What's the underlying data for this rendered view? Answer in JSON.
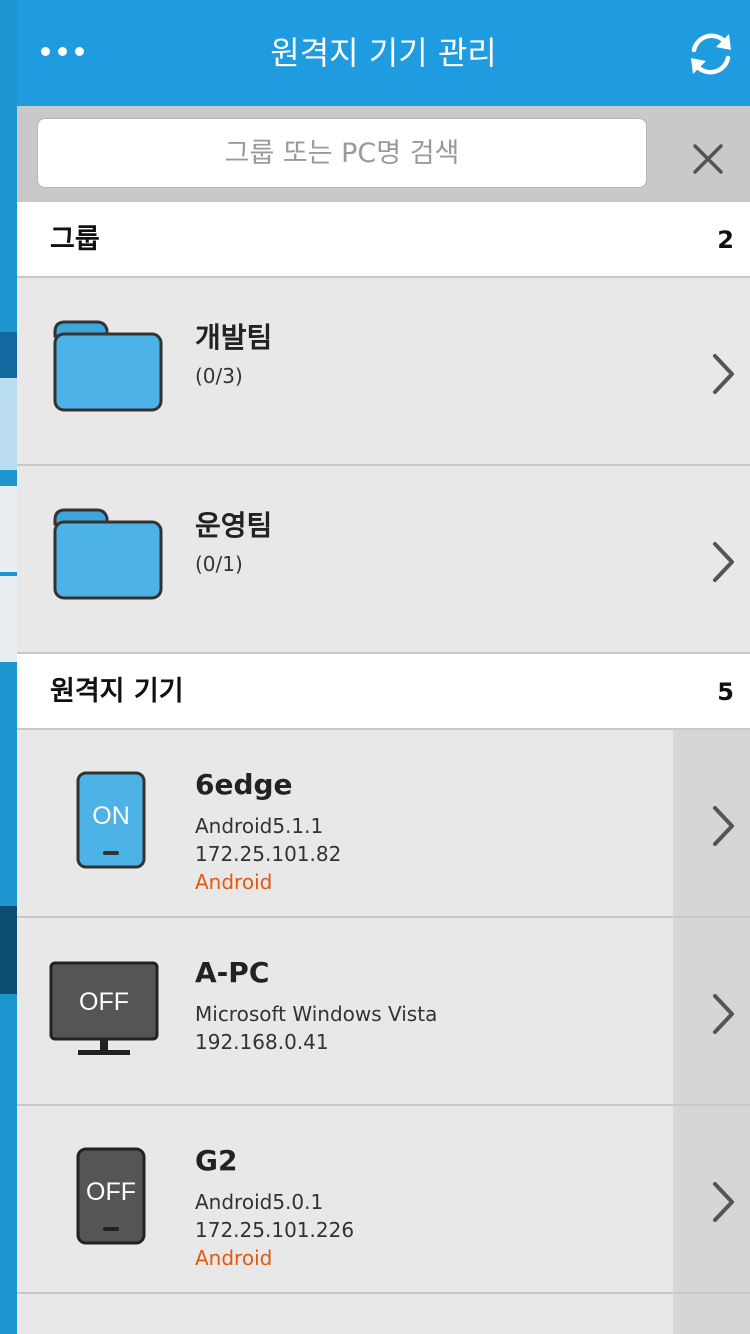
{
  "header": {
    "title": "원격지 기기 관리",
    "menu_icon": "more-dots-icon",
    "refresh_icon": "refresh-icon"
  },
  "search": {
    "placeholder": "그룹 또는 PC명 검색",
    "value": "",
    "clear_icon": "close-icon"
  },
  "groups": {
    "title": "그룹",
    "count": "2",
    "items": [
      {
        "name": "개발팀",
        "count": "(0/3)"
      },
      {
        "name": "운영팀",
        "count": "(0/1)"
      }
    ]
  },
  "devices": {
    "title": "원격지 기기",
    "count": "5",
    "items": [
      {
        "name": "6edge",
        "line1": "Android5.1.1",
        "line2": "172.25.101.82",
        "os": "Android",
        "status": "ON",
        "kind": "phone"
      },
      {
        "name": "A-PC",
        "line1": "Microsoft Windows Vista",
        "line2": "192.168.0.41",
        "os": "",
        "status": "OFF",
        "kind": "monitor"
      },
      {
        "name": "G2",
        "line1": "Android5.0.1",
        "line2": "172.25.101.226",
        "os": "Android",
        "status": "OFF",
        "kind": "phone"
      }
    ]
  },
  "colors": {
    "header": "#1f9be0",
    "folder": "#4db3e6",
    "on_device": "#4db3e6",
    "off_device": "#555555",
    "os_label": "#e05a10"
  }
}
